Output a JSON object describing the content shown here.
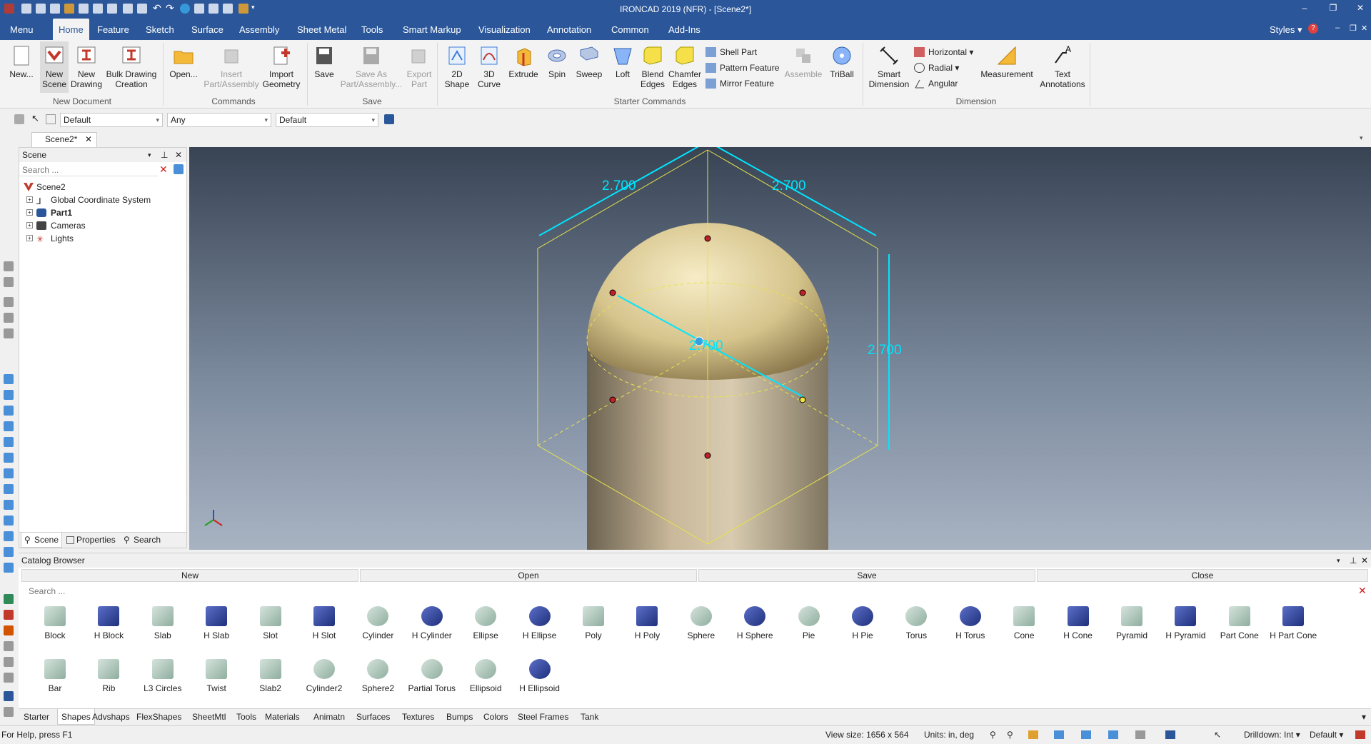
{
  "app": {
    "title": "IRONCAD 2019 (NFR) - [Scene2*]",
    "styles_label": "Styles"
  },
  "tabs": [
    "Menu",
    "Home",
    "Feature",
    "Sketch",
    "Surface",
    "Assembly",
    "Sheet Metal",
    "Tools",
    "Smart Markup",
    "Visualization",
    "Annotation",
    "Common",
    "Add-Ins"
  ],
  "ribbon": {
    "new": "New...",
    "new_scene_1": "New",
    "new_scene_2": "Scene",
    "new_drawing_1": "New",
    "new_drawing_2": "Drawing",
    "bulk_1": "Bulk Drawing",
    "bulk_2": "Creation",
    "group_new_document": "New Document",
    "open": "Open...",
    "insert_1": "Insert",
    "insert_2": "Part/Assembly",
    "import_1": "Import",
    "import_2": "Geometry",
    "group_commands": "Commands",
    "save": "Save",
    "save_as_1": "Save As",
    "save_as_2": "Part/Assembly...",
    "export_1": "Export",
    "export_2": "Part",
    "group_save": "Save",
    "shape2d_1": "2D",
    "shape2d_2": "Shape",
    "curve3d_1": "3D",
    "curve3d_2": "Curve",
    "extrude": "Extrude",
    "spin": "Spin",
    "sweep": "Sweep",
    "loft": "Loft",
    "blend_1": "Blend",
    "blend_2": "Edges",
    "chamfer_1": "Chamfer",
    "chamfer_2": "Edges",
    "shell_part": "Shell Part",
    "pattern_feature": "Pattern Feature",
    "mirror_feature": "Mirror Feature",
    "assemble": "Assemble",
    "triball": "TriBall",
    "group_starter": "Starter Commands",
    "smart_dim_1": "Smart",
    "smart_dim_2": "Dimension",
    "horizontal": "Horizontal",
    "radial": "Radial",
    "angular": "Angular",
    "measurement": "Measurement",
    "text_annot_1": "Text",
    "text_annot_2": "Annotations",
    "group_dimension": "Dimension"
  },
  "selection_bar": {
    "combo1": "Default",
    "combo2": "Any",
    "combo3": "Default"
  },
  "document_tab": "Scene2*",
  "scene_panel": {
    "title": "Scene",
    "search_placeholder": "Search ...",
    "tree": [
      "Scene2",
      "Global Coordinate System",
      "Part1",
      "Cameras",
      "Lights"
    ],
    "bottom_tabs": [
      "Scene",
      "Properties",
      "Search"
    ]
  },
  "viewport": {
    "dim_top_left": "2.700",
    "dim_top_right": "2.700",
    "dim_right": "2.700",
    "dim_center": "2.700"
  },
  "catalog": {
    "title": "Catalog Browser",
    "buttons": [
      "New",
      "Open",
      "Save",
      "Close"
    ],
    "search_placeholder": "Search ...",
    "shapes_row1": [
      "Block",
      "H Block",
      "Slab",
      "H Slab",
      "Slot",
      "H Slot",
      "Cylinder",
      "H Cylinder",
      "Ellipse",
      "H Ellipse",
      "Poly",
      "H Poly",
      "Sphere",
      "H Sphere",
      "Pie",
      "H Pie",
      "Torus",
      "H Torus",
      "Cone",
      "H Cone",
      "Pyramid",
      "H Pyramid",
      "Part Cone",
      "H Part Cone"
    ],
    "shapes_row2": [
      "Bar",
      "Rib",
      "L3 Circles",
      "Twist",
      "Slab2",
      "Cylinder2",
      "Sphere2",
      "Partial Torus",
      "Ellipsoid",
      "H Ellipsoid"
    ],
    "tabs": [
      "Starter",
      "Shapes",
      "Advshaps",
      "FlexShapes",
      "SheetMtl",
      "Tools",
      "Materials",
      "Animatn",
      "Surfaces",
      "Textures",
      "Bumps",
      "Colors",
      "Steel Frames",
      "Tank"
    ]
  },
  "status": {
    "help": "For Help, press F1",
    "view_size": "View size: 1656 x  564",
    "units": "Units: in, deg",
    "drilldown": "Drilldown: Int",
    "default": "Default"
  },
  "colors": {
    "title_blue": "#2b579a",
    "dimension_cyan": "#00e5ff",
    "bbox_yellow": "#e8e24a"
  }
}
